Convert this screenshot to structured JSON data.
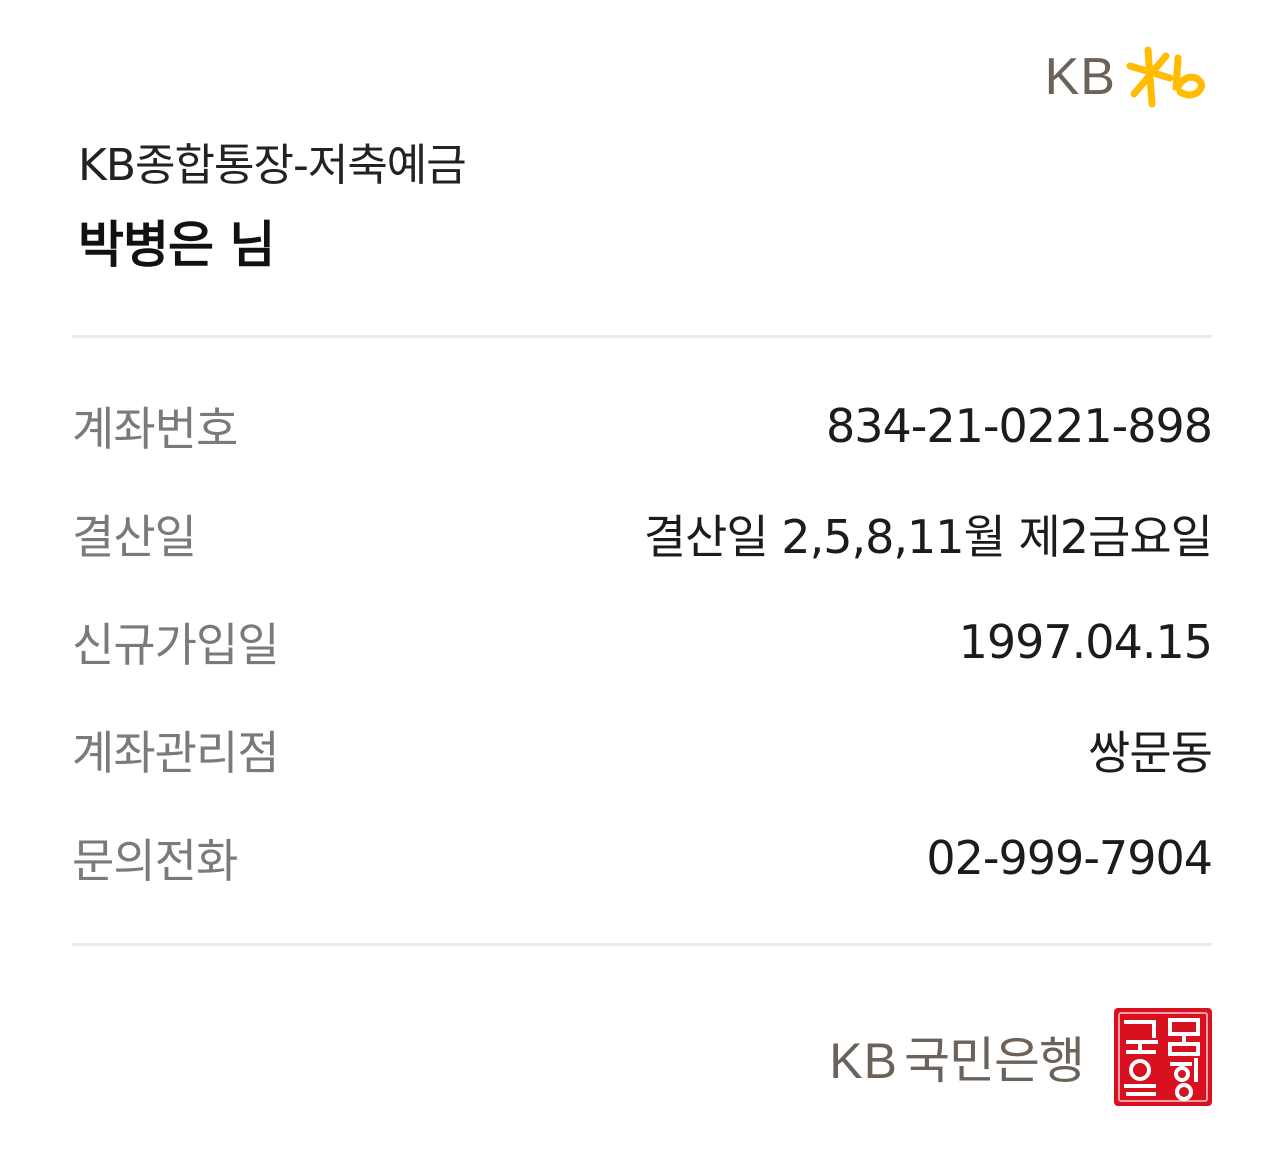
{
  "brand": {
    "logo_text": "KB",
    "logo_mark": "kb-star-mark",
    "logo_color": "#6b6259",
    "mark_color": "#ffbc00"
  },
  "account": {
    "product_name": "KB종합통장-저축예금",
    "owner_name": "박병은 님"
  },
  "details": [
    {
      "label": "계좌번호",
      "value": "834-21-0221-898"
    },
    {
      "label": "결산일",
      "value": "결산일 2,5,8,11월 제2금요일"
    },
    {
      "label": "신규가입일",
      "value": "1997.04.15"
    },
    {
      "label": "계좌관리점",
      "value": "쌍문동"
    },
    {
      "label": "문의전화",
      "value": "02-999-7904"
    }
  ],
  "footer": {
    "bank_prefix": "KB",
    "bank_name": "국민은행",
    "seal_text": "국민은행",
    "seal_color": "#d8101f"
  }
}
